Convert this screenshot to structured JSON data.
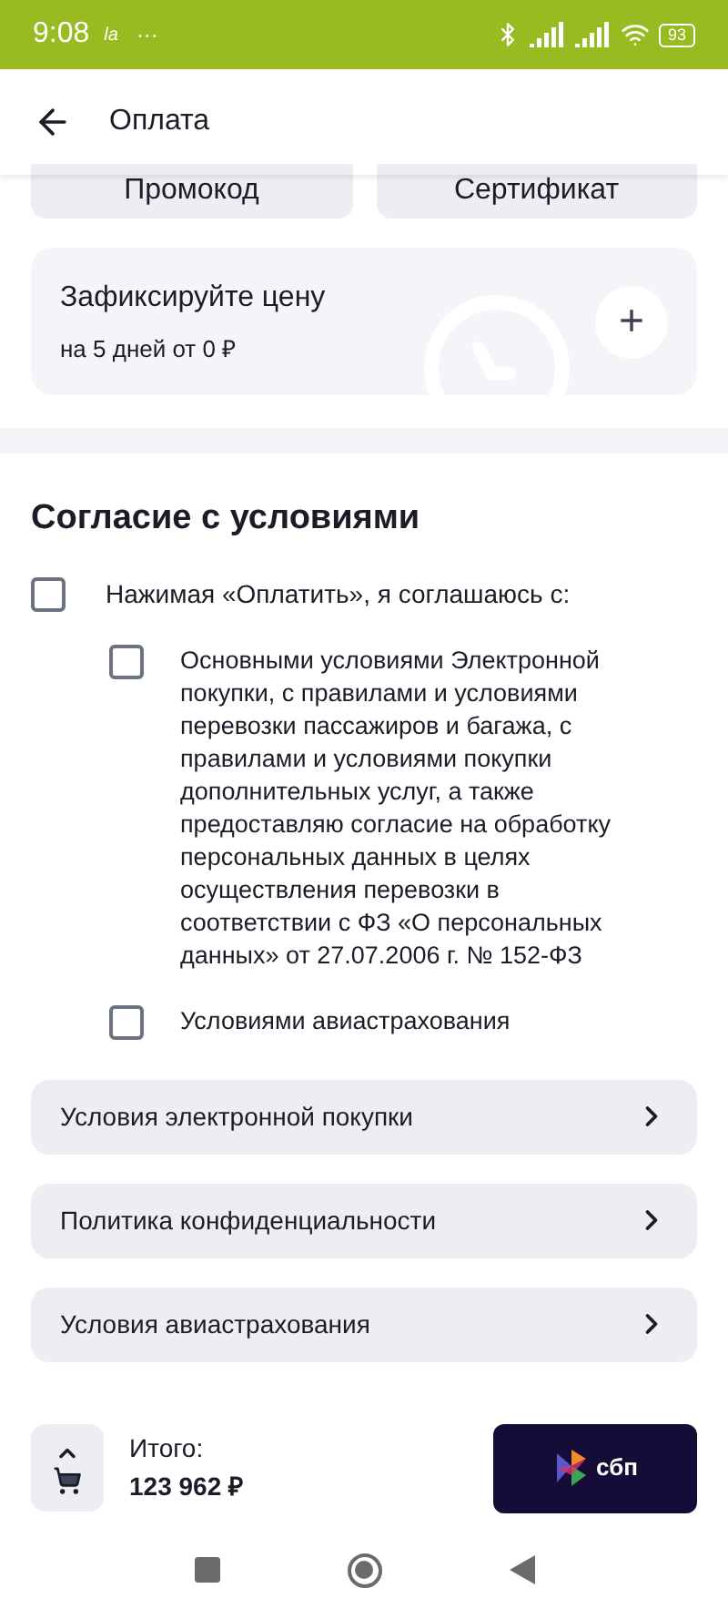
{
  "status_bar": {
    "time": "9:08",
    "carrier": "la",
    "more": "···",
    "battery": "93"
  },
  "header": {
    "title": "Оплата"
  },
  "promo_buttons": [
    "Промокод",
    "Сертификат"
  ],
  "price_lock": {
    "title": "Зафиксируйте цену",
    "subtitle": "на 5 дней от 0 ₽",
    "add": "+"
  },
  "consent": {
    "title": "Согласие с условиями",
    "main": {
      "label": "Нажимая «Оплатить», я соглашаюсь с:",
      "checked": false
    },
    "items": [
      {
        "label": "Основными условиями Электронной покупки, с правилами и условиями перевозки пассажиров и багажа, с правилами и условиями покупки дополнительных услуг, а также предоставляю согласие на обработку персональных данных в целях осуществления перевозки в соответствии с ФЗ «О персональных данных» от 27.07.2006 г. № 152-ФЗ",
        "checked": false
      },
      {
        "label": "Условиями авиастрахования",
        "checked": false
      }
    ]
  },
  "links": [
    "Условия электронной покупки",
    "Политика конфиденциальности",
    "Условия авиастрахования"
  ],
  "footer": {
    "total_label": "Итого:",
    "total": "123 962 ₽",
    "pay_label": "сбп"
  }
}
